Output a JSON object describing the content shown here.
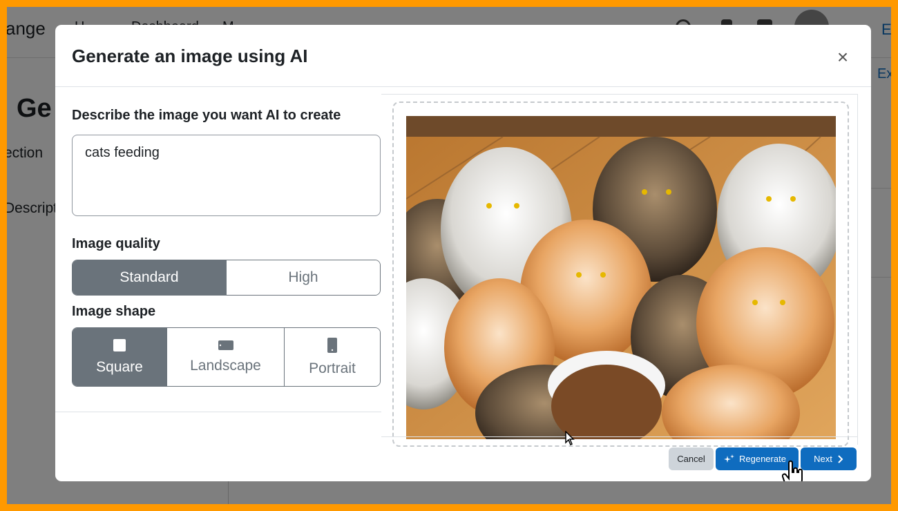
{
  "background_page": {
    "brand_fragment": "ange",
    "nav_fragments": [
      "H",
      "Dashboard",
      "M"
    ],
    "edit_fragment": "E",
    "ex_fragment": "Ex",
    "title_fragment": "Ge",
    "section_fragment": "ection",
    "description_fragment": "Descript"
  },
  "modal": {
    "title": "Generate an image using AI",
    "close_label": "×",
    "prompt_label": "Describe the image you want AI to create",
    "prompt_value": "cats feeding",
    "quality_label": "Image quality",
    "quality_options": [
      "Standard",
      "High"
    ],
    "quality_selected": "Standard",
    "shape_label": "Image shape",
    "shape_options": [
      "Square",
      "Landscape",
      "Portrait"
    ],
    "shape_selected": "Square",
    "buttons": {
      "cancel": "Cancel",
      "regenerate": "Regenerate",
      "next": "Next"
    }
  },
  "colors": {
    "primary": "#0f6cbf",
    "secondary": "#6a737b",
    "cancel_bg": "#ced4da",
    "frame": "#ff9900"
  },
  "icons": [
    "close-icon",
    "square-icon",
    "landscape-icon",
    "portrait-icon",
    "sparkle-icon",
    "chevron-right-icon",
    "hand-cursor-icon",
    "arrow-cursor-icon"
  ]
}
